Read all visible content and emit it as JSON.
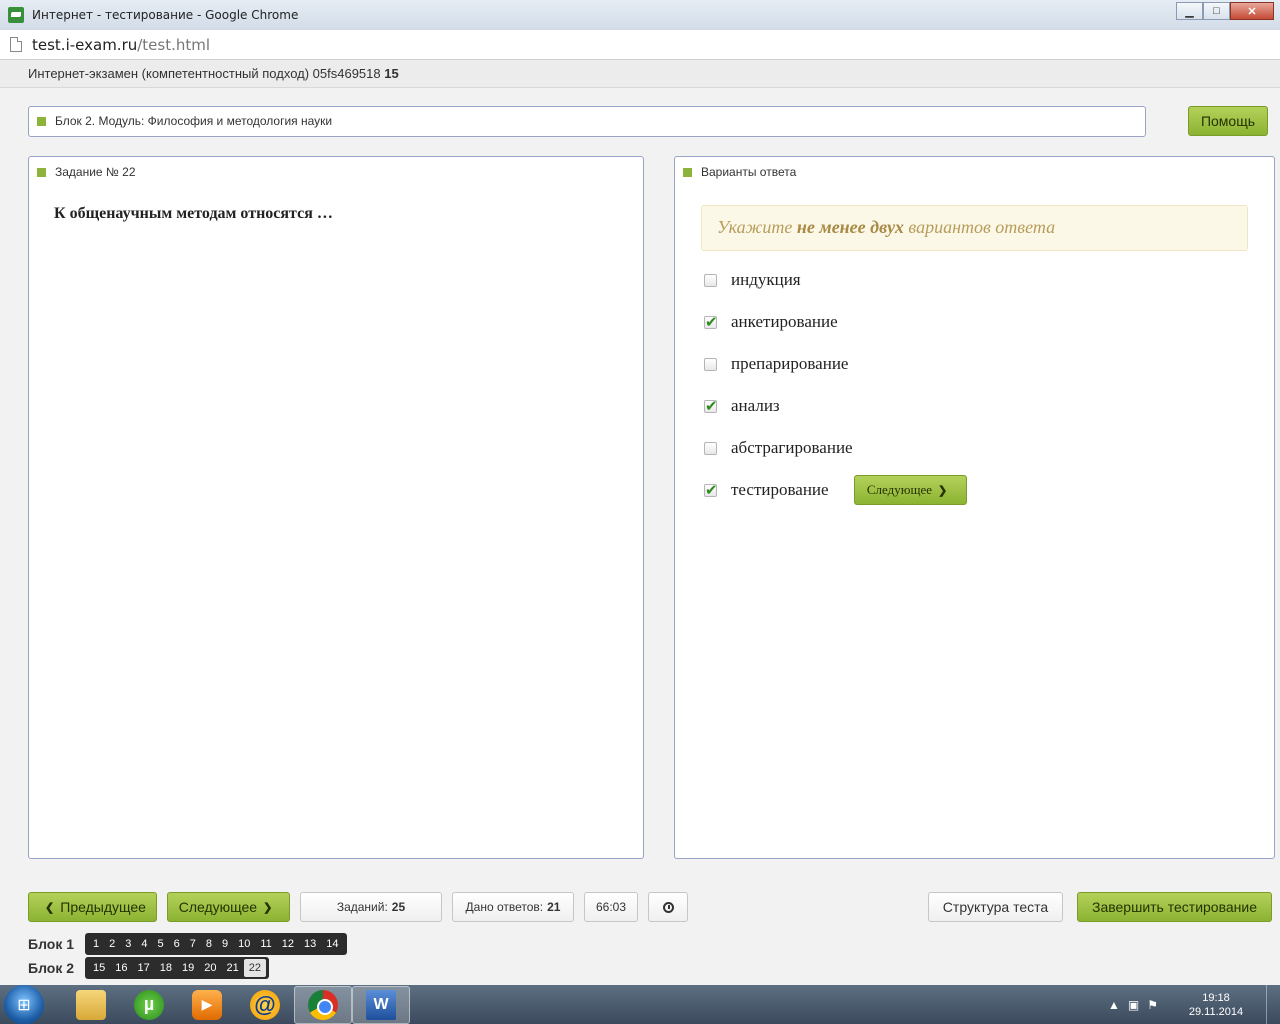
{
  "window": {
    "title": "Интернет - тестирование - Google Chrome",
    "minimize_glyph": "▁",
    "maximize_glyph": "□",
    "close_glyph": "✕"
  },
  "address": {
    "host": "test.i-exam.ru",
    "path": "/test.html"
  },
  "exam": {
    "title": "Интернет-экзамен (компетентностный подход) 05fs469518",
    "number": "15"
  },
  "block": {
    "title": "Блок 2. Модуль: Философия и методология науки"
  },
  "help_label": "Помощь",
  "task": {
    "header": "Задание № 22",
    "question": "К общенаучным методам относятся …"
  },
  "answers": {
    "header": "Варианты ответа",
    "hint_prefix": "Укажите",
    "hint_bold": "не менее двух",
    "hint_suffix": "вариантов ответа",
    "options": [
      {
        "label": "индукция",
        "checked": false
      },
      {
        "label": "анкетирование",
        "checked": true
      },
      {
        "label": "препарирование",
        "checked": false
      },
      {
        "label": "анализ",
        "checked": true
      },
      {
        "label": "абстрагирование",
        "checked": false
      },
      {
        "label": "тестирование",
        "checked": true
      }
    ],
    "next_label": "Следующее"
  },
  "footer": {
    "prev_label": "Предыдущее",
    "next_label": "Следующее",
    "tasks_label": "Заданий:",
    "tasks_count": "25",
    "answered_label": "Дано ответов:",
    "answered_count": "21",
    "timer": "66:03",
    "structure_label": "Структура теста",
    "finish_label": "Завершить тестирование"
  },
  "blocks": [
    {
      "label": "Блок 1",
      "numbers": [
        "1",
        "2",
        "3",
        "4",
        "5",
        "6",
        "7",
        "8",
        "9",
        "10",
        "11",
        "12",
        "13",
        "14"
      ]
    },
    {
      "label": "Блок 2",
      "numbers": [
        "15",
        "16",
        "17",
        "18",
        "19",
        "20",
        "21",
        "22"
      ]
    }
  ],
  "current_question": "22",
  "taskbar": {
    "time": "19:18",
    "date": "29.11.2014",
    "apps": [
      "explorer-icon",
      "utorrent-icon",
      "media-player-icon",
      "mail-agent-icon",
      "chrome-icon",
      "word-icon"
    ]
  },
  "colors": {
    "accent_green": "#8db33a",
    "panel_border": "#9aa3c8",
    "hint_text": "#b89c5a"
  }
}
